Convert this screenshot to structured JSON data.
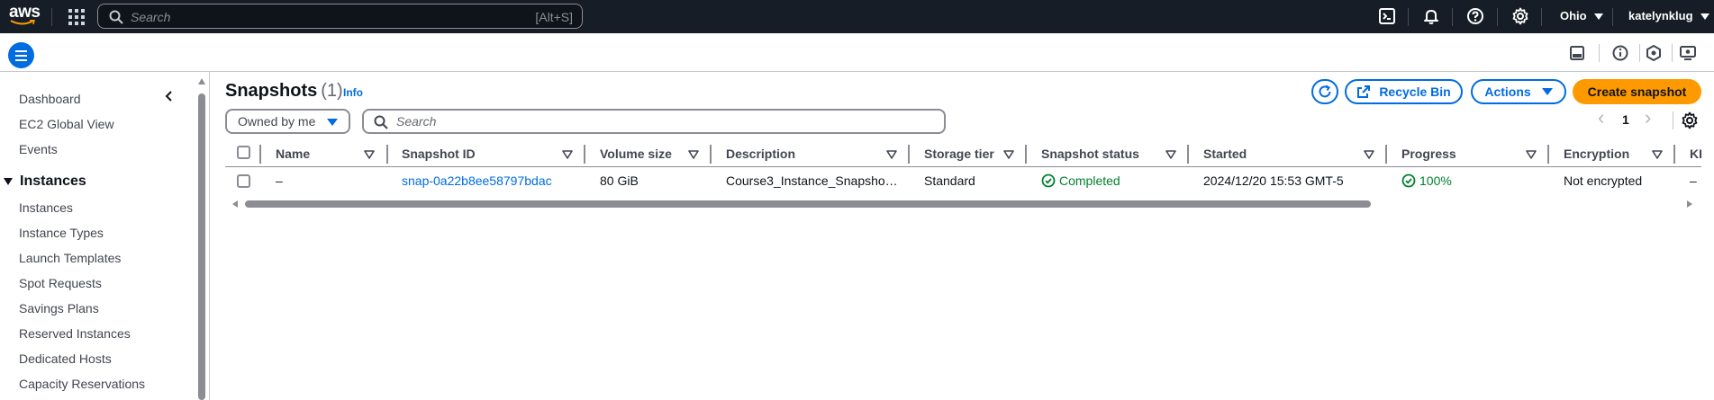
{
  "topnav": {
    "logo_text": "aws",
    "search_placeholder": "Search",
    "search_shortcut": "[Alt+S]",
    "region": "Ohio",
    "user": "katelynklug"
  },
  "sidebar": {
    "items_top": [
      "Dashboard",
      "EC2 Global View",
      "Events"
    ],
    "section_title": "Instances",
    "items_instances": [
      "Instances",
      "Instance Types",
      "Launch Templates",
      "Spot Requests",
      "Savings Plans",
      "Reserved Instances",
      "Dedicated Hosts",
      "Capacity Reservations"
    ]
  },
  "main": {
    "title": "Snapshots",
    "count": "(1)",
    "info_label": "Info",
    "recycle_bin_label": "Recycle Bin",
    "actions_label": "Actions",
    "create_label": "Create snapshot",
    "owned_filter": "Owned by me",
    "filter_placeholder": "Search",
    "page_number": "1",
    "prev_glyph": "‹",
    "next_glyph": "›"
  },
  "table": {
    "columns": [
      "Name",
      "Snapshot ID",
      "Volume size",
      "Description",
      "Storage tier",
      "Snapshot status",
      "Started",
      "Progress",
      "Encryption",
      "KI"
    ],
    "rows": [
      {
        "name": "–",
        "snapshot_id": "snap-0a22b8ee58797bdac",
        "volume_size": "80 GiB",
        "description": "Course3_Instance_Snapsho…",
        "storage_tier": "Standard",
        "status": "Completed",
        "started": "2024/12/20 15:53 GMT-5",
        "progress": "100%",
        "encryption": "Not encrypted",
        "kms": "–"
      }
    ]
  },
  "colors": {
    "nav_bg": "#161d26",
    "link_blue": "#006ce0",
    "primary_orange": "#ff9900",
    "success_green": "#00802f"
  }
}
